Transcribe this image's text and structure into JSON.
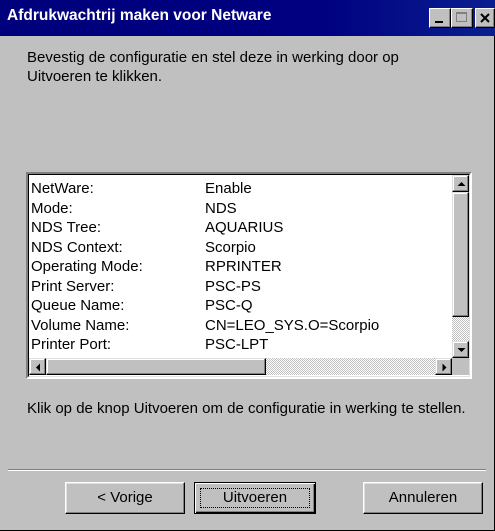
{
  "window": {
    "title": "Afdrukwachtrij maken voor Netware"
  },
  "intro_text": "Bevestig de configuratie en stel deze in werking door op Uitvoeren te klikken.",
  "config_list": {
    "rows": [
      {
        "label": "NetWare:",
        "value": "Enable"
      },
      {
        "label": "Mode:",
        "value": "NDS"
      },
      {
        "label": "NDS Tree:",
        "value": "AQUARIUS"
      },
      {
        "label": "NDS Context:",
        "value": "Scorpio"
      },
      {
        "label": "Operating Mode:",
        "value": "RPRINTER"
      },
      {
        "label": "Print Server:",
        "value": "PSC-PS"
      },
      {
        "label": "Queue Name:",
        "value": "PSC-Q"
      },
      {
        "label": "Volume Name:",
        "value": "CN=LEO_SYS.O=Scorpio"
      },
      {
        "label": "Printer Port:",
        "value": "PSC-LPT"
      }
    ]
  },
  "footer_text": "Klik op de knop Uitvoeren om de configuratie in werking te stellen.",
  "buttons": {
    "back": "< Vorige",
    "run": "Uitvoeren",
    "cancel": "Annuleren"
  },
  "icons": {
    "minimize": "minimize-icon",
    "maximize": "maximize-icon",
    "close": "close-icon",
    "scroll_up": "arrow-up-icon",
    "scroll_down": "arrow-down-icon",
    "scroll_left": "arrow-left-icon",
    "scroll_right": "arrow-right-icon"
  }
}
